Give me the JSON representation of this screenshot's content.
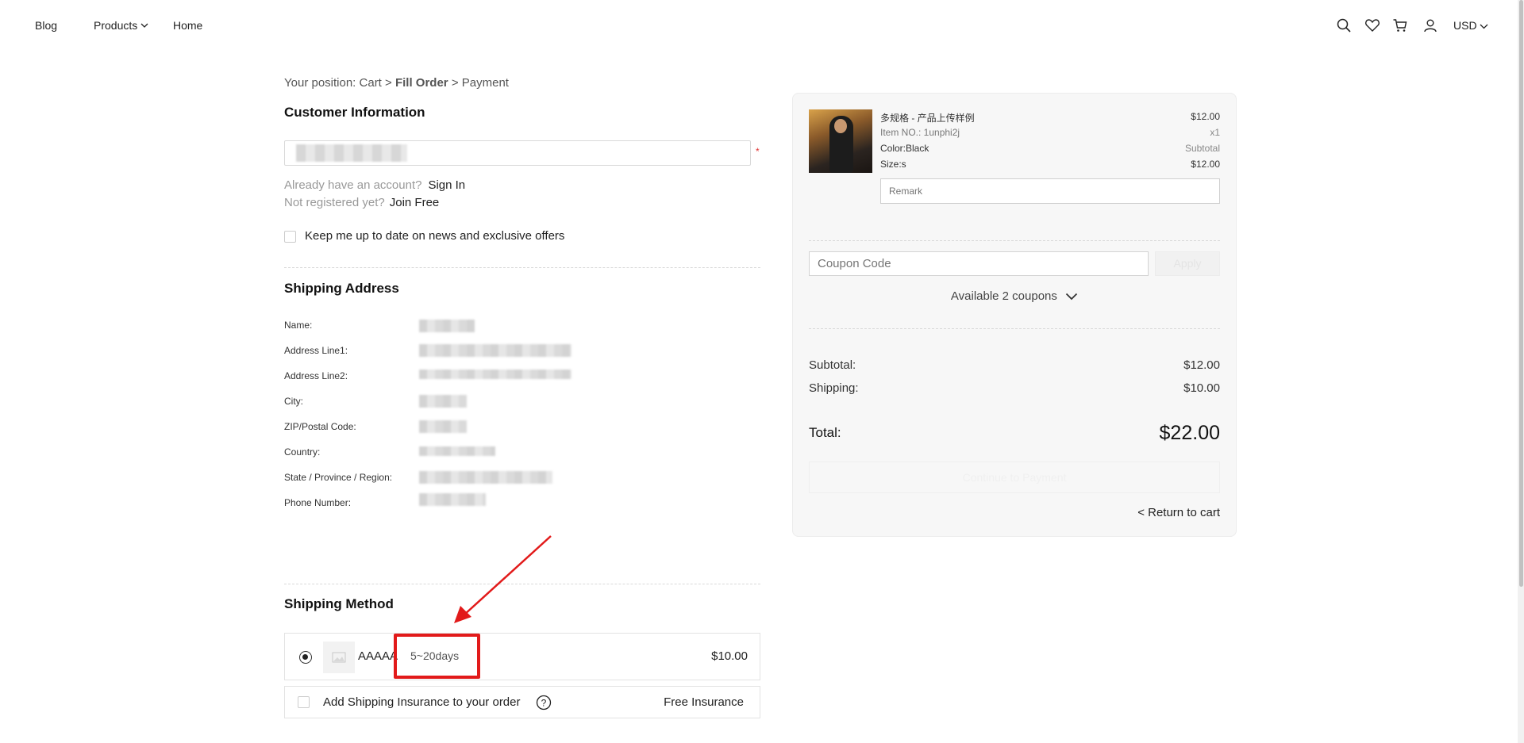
{
  "header": {
    "nav": [
      "Blog",
      "Products",
      "Home"
    ],
    "currency": "USD"
  },
  "breadcrumb": {
    "prefix": "Your position: ",
    "cart": "Cart",
    "sep": ">",
    "current": "Fill Order",
    "payment": "Payment"
  },
  "customer": {
    "title": "Customer Information",
    "required_mark": "*",
    "have_account": "Already have an account?",
    "sign_in": "Sign In",
    "not_registered": "Not registered yet?",
    "join_free": "Join Free",
    "newsletter": "Keep me up to date on news and exclusive offers"
  },
  "shipping_address": {
    "title": "Shipping Address",
    "labels": [
      "Name:",
      "Address Line1:",
      "Address Line2:",
      "City:",
      "ZIP/Postal Code:",
      "Country:",
      "State / Province / Region:",
      "Phone Number:"
    ]
  },
  "shipping_method": {
    "title": "Shipping Method",
    "carrier": "AAAAA",
    "days": "5~20days",
    "price": "$10.00",
    "insurance_label": "Add Shipping Insurance to your order",
    "insurance_value": "Free Insurance"
  },
  "summary": {
    "product": {
      "name": "多规格 - 产品上传样例",
      "item_no": "Item NO.: 1unphi2j",
      "color": "Color:Black",
      "size": "Size:s",
      "price": "$12.00",
      "qty": "x1",
      "subtotal_label": "Subtotal",
      "subtotal": "$12.00"
    },
    "remark_placeholder": "Remark",
    "coupon_placeholder": "Coupon Code",
    "apply": "Apply",
    "available_coupons": "Available 2 coupons",
    "subtotal_label": "Subtotal:",
    "subtotal": "$12.00",
    "shipping_label": "Shipping:",
    "shipping": "$10.00",
    "total_label": "Total:",
    "total": "$22.00",
    "continue": "Continue to Payment",
    "return": "< Return to cart"
  }
}
